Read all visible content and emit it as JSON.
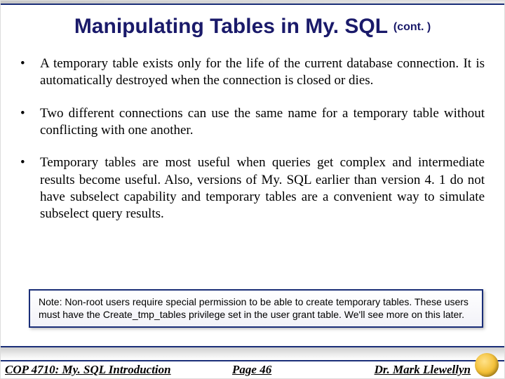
{
  "title": {
    "main": "Manipulating Tables in My. SQL ",
    "suffix": "(cont. )"
  },
  "bullets": [
    "A temporary table exists only for the life of the current database connection.  It is automatically destroyed when the connection is closed or dies.",
    "Two different connections can use the same name for a temporary table without conflicting with one another.",
    "Temporary tables are most useful when queries get complex and intermediate results become useful.  Also, versions of My. SQL earlier than version 4. 1 do not have subselect capability and temporary tables are a convenient way to simulate subselect query results."
  ],
  "note": "Note:  Non-root users require special permission to be able to create temporary tables.  These users must have the Create_tmp_tables privilege set in the user grant table.  We'll see more on this later.",
  "footer": {
    "course": "COP 4710: My. SQL Introduction",
    "page": "Page 46",
    "author": "Dr. Mark Llewellyn"
  }
}
